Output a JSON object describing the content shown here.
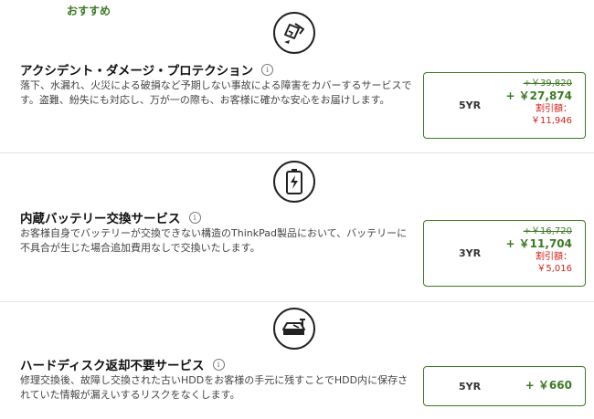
{
  "recommend_label": "おすすめ",
  "colors": {
    "accent": "#3c7a22",
    "discount": "#d2231a"
  },
  "services": [
    {
      "icon": "broken-device-icon",
      "title": "アクシデント・ダメージ・プロテクション",
      "info": "i",
      "desc": "落下、水漏れ、火災による破損など予期しない事故による障害をカバーするサービスです。盗難、紛失にも対応し、万が一の際も、お客様に確かな安心をお届けします。",
      "term": "5YR",
      "old_price": "+￥39,820",
      "new_price": "+ ￥27,874",
      "discount_label": "割引額：",
      "discount_value": "￥11,946"
    },
    {
      "icon": "battery-icon",
      "title": "内蔵バッテリー交換サービス",
      "info": "i",
      "desc": "お客様自身でバッテリーが交換できない構造のThinkPad製品において、バッテリーに不具合が生じた場合追加費用なしで交換いたします。",
      "term": "3YR",
      "old_price": "+￥16,720",
      "new_price": "+ ￥11,704",
      "discount_label": "割引額：",
      "discount_value": "￥5,016"
    },
    {
      "icon": "hard-drive-icon",
      "title": "ハードディスク返却不要サービス",
      "info": "i",
      "desc": "修理交換後、故障し交換された古いHDDをお客様の手元に残すことでHDD内に保存されていた情報が漏えいするリスクをなくします。",
      "term": "5YR",
      "new_price": "+ ￥660"
    }
  ]
}
